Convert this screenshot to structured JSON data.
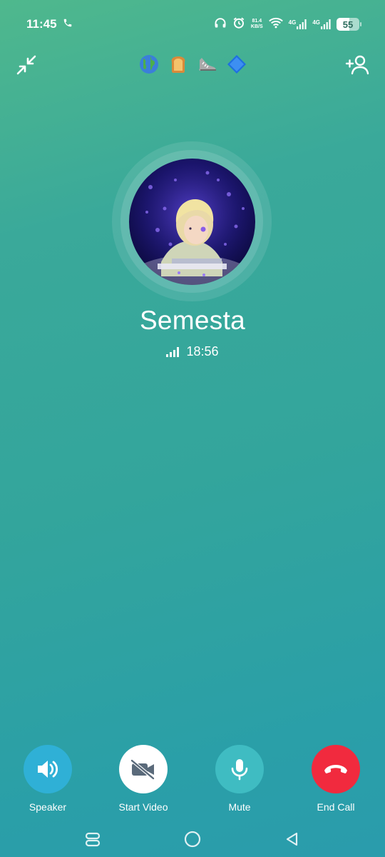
{
  "status_bar": {
    "time": "11:45",
    "net_speed_value": "81.4",
    "net_speed_unit": "KB/S",
    "sim1_type": "4G",
    "sim2_type": "4G",
    "battery_level": "55"
  },
  "toolbar": {
    "emoji_key": [
      "🌎",
      "🍞",
      "👟",
      "🔷"
    ]
  },
  "caller": {
    "name": "Semesta",
    "duration": "18:56"
  },
  "controls": {
    "speaker_label": "Speaker",
    "video_label": "Start Video",
    "mute_label": "Mute",
    "end_label": "End Call"
  },
  "colors": {
    "speaker": "#2fb0d6",
    "video": "#ffffff",
    "mute": "#3fbcc2",
    "end_call": "#f12a3e"
  }
}
